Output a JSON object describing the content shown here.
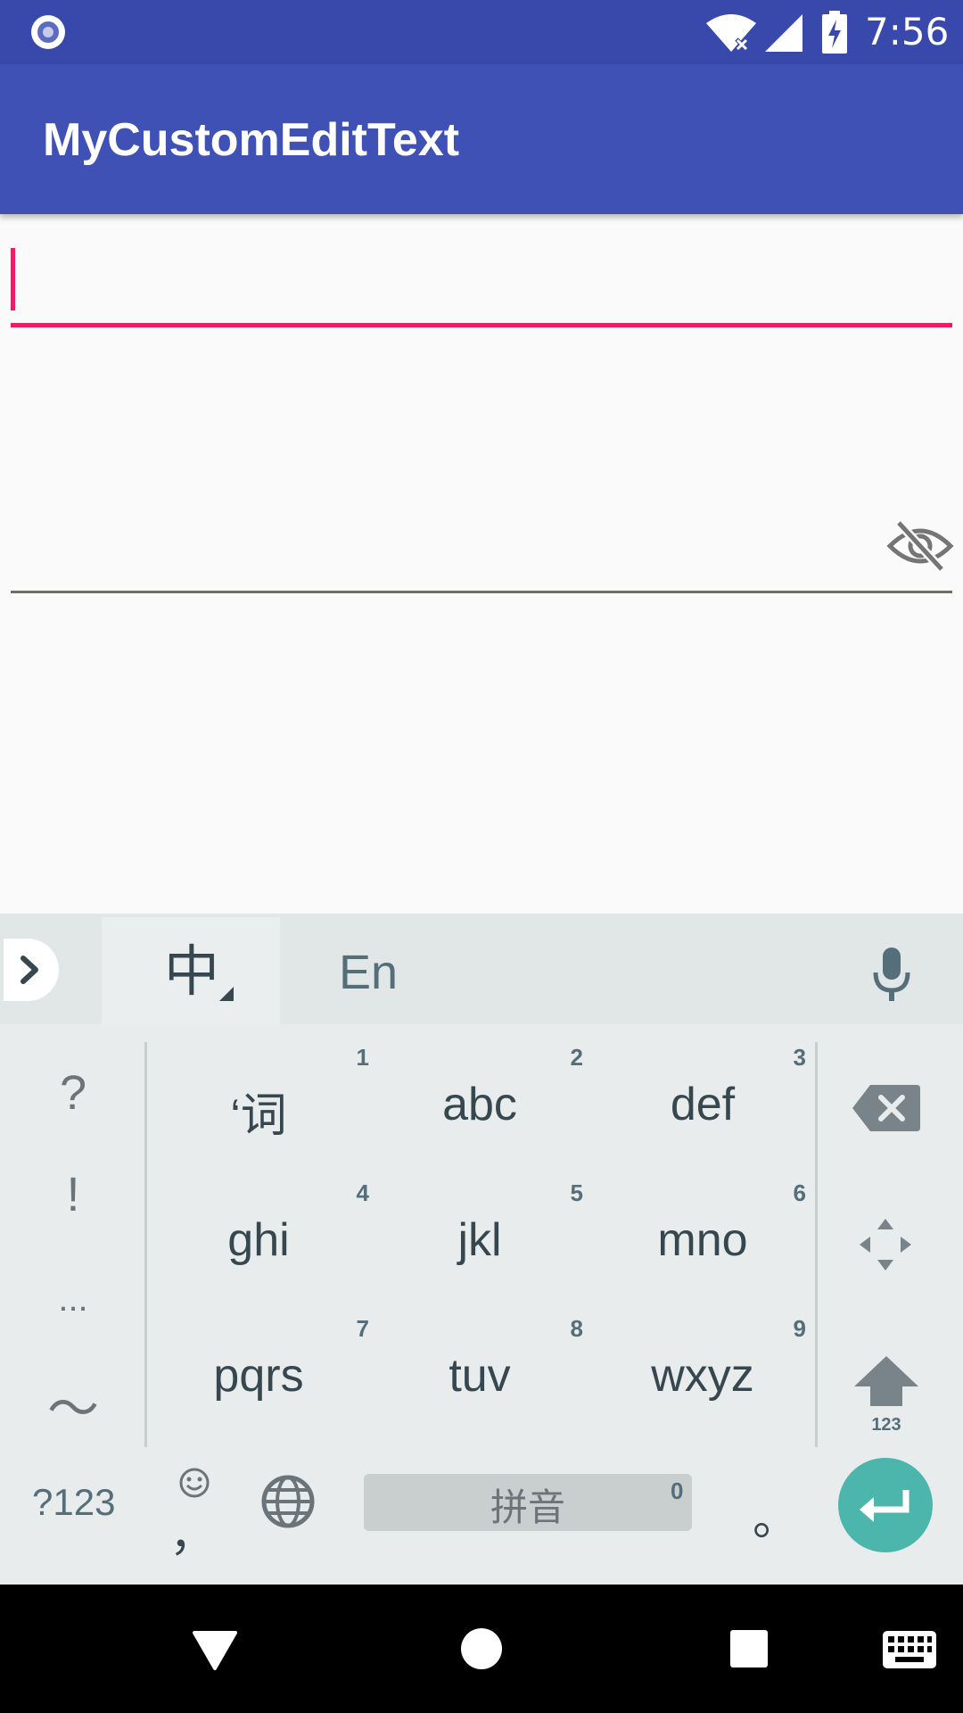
{
  "status_bar": {
    "time": "7:56",
    "icons": [
      "notification-circle-icon",
      "wifi-off-icon",
      "signal-icon",
      "battery-charging-icon"
    ]
  },
  "app_bar": {
    "title": "MyCustomEditText"
  },
  "colors": {
    "primary": "#3f51b5",
    "primary_dark": "#3949ab",
    "accent": "#e91e63",
    "keyboard_bg": "#e8ecec",
    "enter_key": "#4db6ac"
  },
  "fields": [
    {
      "name": "text-field",
      "value": "",
      "focused": true
    },
    {
      "name": "password-field",
      "value": "",
      "toggle_icon": "eye-off-icon"
    }
  ],
  "keyboard": {
    "toolbar": {
      "lang_chinese": "中",
      "lang_english": "En"
    },
    "symbols": [
      "?",
      "!",
      "...",
      "～"
    ],
    "keys": [
      {
        "label": "‘词",
        "num": "1"
      },
      {
        "label": "abc",
        "num": "2"
      },
      {
        "label": "def",
        "num": "3"
      },
      {
        "label": "ghi",
        "num": "4"
      },
      {
        "label": "jkl",
        "num": "5"
      },
      {
        "label": "mno",
        "num": "6"
      },
      {
        "label": "pqrs",
        "num": "7"
      },
      {
        "label": "tuv",
        "num": "8"
      },
      {
        "label": "wxyz",
        "num": "9"
      }
    ],
    "shift_label": "123",
    "bottom": {
      "sym_switch": "?123",
      "comma": "，",
      "space_label": "拼音",
      "space_num": "0",
      "period": "。"
    }
  }
}
